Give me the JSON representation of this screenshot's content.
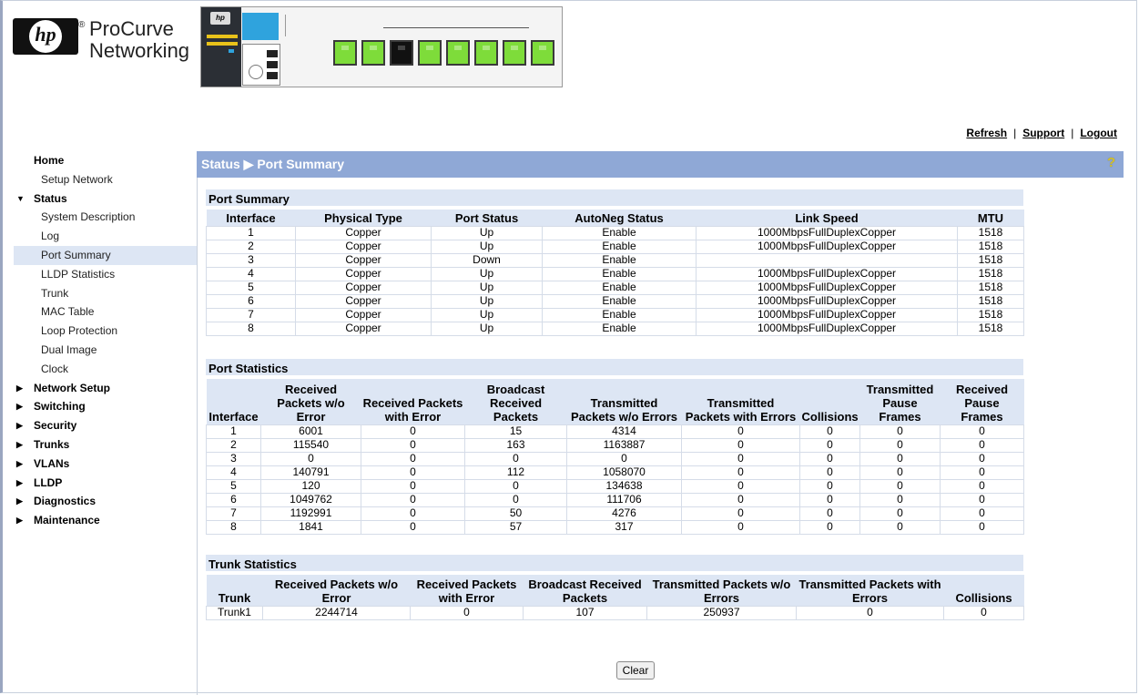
{
  "brand": {
    "line1": "ProCurve",
    "line2": "Networking",
    "reg": "®",
    "hp": "hp"
  },
  "toplinks": {
    "refresh": "Refresh",
    "support": "Support",
    "logout": "Logout",
    "sep": "|"
  },
  "sidebar": {
    "items": [
      {
        "label": "Home",
        "level": "top",
        "arrow": ""
      },
      {
        "label": "Setup Network",
        "level": "sub"
      },
      {
        "label": "Status",
        "level": "top",
        "arrow": "▼"
      },
      {
        "label": "System Description",
        "level": "sub"
      },
      {
        "label": "Log",
        "level": "sub"
      },
      {
        "label": "Port Summary",
        "level": "sub",
        "selected": true
      },
      {
        "label": "LLDP Statistics",
        "level": "sub"
      },
      {
        "label": "Trunk",
        "level": "sub"
      },
      {
        "label": "MAC Table",
        "level": "sub"
      },
      {
        "label": "Loop Protection",
        "level": "sub"
      },
      {
        "label": "Dual Image",
        "level": "sub"
      },
      {
        "label": "Clock",
        "level": "sub"
      },
      {
        "label": "Network Setup",
        "level": "top",
        "arrow": "▶"
      },
      {
        "label": "Switching",
        "level": "top",
        "arrow": "▶"
      },
      {
        "label": "Security",
        "level": "top",
        "arrow": "▶"
      },
      {
        "label": "Trunks",
        "level": "top",
        "arrow": "▶"
      },
      {
        "label": "VLANs",
        "level": "top",
        "arrow": "▶"
      },
      {
        "label": "LLDP",
        "level": "top",
        "arrow": "▶"
      },
      {
        "label": "Diagnostics",
        "level": "top",
        "arrow": "▶"
      },
      {
        "label": "Maintenance",
        "level": "top",
        "arrow": "▶"
      }
    ]
  },
  "titlebar": {
    "text": "Status ▶ Port Summary",
    "help": "?"
  },
  "port_summary": {
    "heading": "Port Summary",
    "headers": [
      "Interface",
      "Physical Type",
      "Port Status",
      "AutoNeg Status",
      "Link Speed",
      "MTU"
    ],
    "rows": [
      [
        "1",
        "Copper",
        "Up",
        "Enable",
        "1000MbpsFullDuplexCopper",
        "1518"
      ],
      [
        "2",
        "Copper",
        "Up",
        "Enable",
        "1000MbpsFullDuplexCopper",
        "1518"
      ],
      [
        "3",
        "Copper",
        "Down",
        "Enable",
        "",
        "1518"
      ],
      [
        "4",
        "Copper",
        "Up",
        "Enable",
        "1000MbpsFullDuplexCopper",
        "1518"
      ],
      [
        "5",
        "Copper",
        "Up",
        "Enable",
        "1000MbpsFullDuplexCopper",
        "1518"
      ],
      [
        "6",
        "Copper",
        "Up",
        "Enable",
        "1000MbpsFullDuplexCopper",
        "1518"
      ],
      [
        "7",
        "Copper",
        "Up",
        "Enable",
        "1000MbpsFullDuplexCopper",
        "1518"
      ],
      [
        "8",
        "Copper",
        "Up",
        "Enable",
        "1000MbpsFullDuplexCopper",
        "1518"
      ]
    ]
  },
  "port_statistics": {
    "heading": "Port Statistics",
    "headers": [
      "Interface",
      "Received Packets w/o Error",
      "Received Packets with Error",
      "Broadcast Received Packets",
      "Transmitted Packets w/o Errors",
      "Transmitted Packets with Errors",
      "Collisions",
      "Transmitted Pause Frames",
      "Received Pause Frames"
    ],
    "rows": [
      [
        "1",
        "6001",
        "0",
        "15",
        "4314",
        "0",
        "0",
        "0",
        "0"
      ],
      [
        "2",
        "115540",
        "0",
        "163",
        "1163887",
        "0",
        "0",
        "0",
        "0"
      ],
      [
        "3",
        "0",
        "0",
        "0",
        "0",
        "0",
        "0",
        "0",
        "0"
      ],
      [
        "4",
        "140791",
        "0",
        "112",
        "1058070",
        "0",
        "0",
        "0",
        "0"
      ],
      [
        "5",
        "120",
        "0",
        "0",
        "134638",
        "0",
        "0",
        "0",
        "0"
      ],
      [
        "6",
        "1049762",
        "0",
        "0",
        "111706",
        "0",
        "0",
        "0",
        "0"
      ],
      [
        "7",
        "1192991",
        "0",
        "50",
        "4276",
        "0",
        "0",
        "0",
        "0"
      ],
      [
        "8",
        "1841",
        "0",
        "57",
        "317",
        "0",
        "0",
        "0",
        "0"
      ]
    ]
  },
  "trunk_statistics": {
    "heading": "Trunk Statistics",
    "headers": [
      "Trunk",
      "Received Packets w/o Error",
      "Received Packets with Error",
      "Broadcast Received Packets",
      "Transmitted Packets w/o Errors",
      "Transmitted Packets with Errors",
      "Collisions"
    ],
    "rows": [
      [
        "Trunk1",
        "2244714",
        "0",
        "107",
        "250937",
        "0",
        "0"
      ]
    ]
  },
  "clear_button": "Clear",
  "switch_image": {
    "port_count": 8,
    "ports_down": [
      3
    ],
    "port_color": "#7edc3a"
  }
}
